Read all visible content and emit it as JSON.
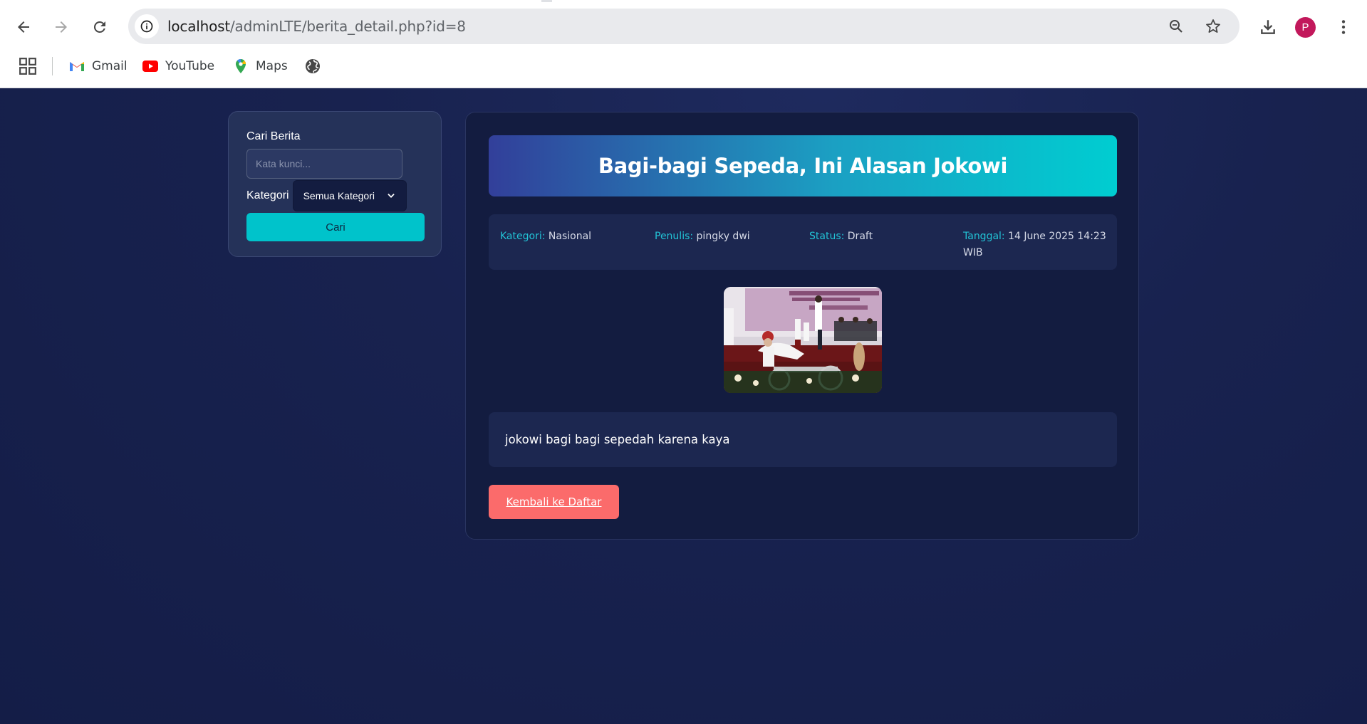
{
  "browser": {
    "url_host": "localhost",
    "url_path": "/adminLTE/berita_detail.php?id=8",
    "profile_initial": "P",
    "bookmarks": [
      {
        "label": "Gmail",
        "icon": "gmail-icon"
      },
      {
        "label": "YouTube",
        "icon": "youtube-icon"
      },
      {
        "label": "Maps",
        "icon": "maps-icon"
      }
    ]
  },
  "sidebar": {
    "search_label": "Cari Berita",
    "search_placeholder": "Kata kunci...",
    "category_label": "Kategori",
    "category_selected": "Semua Kategori",
    "search_button": "Cari"
  },
  "article": {
    "title": "Bagi-bagi Sepeda, Ini Alasan Jokowi",
    "meta": {
      "category_key": "Kategori:",
      "category_value": "Nasional",
      "author_key": "Penulis:",
      "author_value": "pingky dwi",
      "status_key": "Status:",
      "status_value": "Draft",
      "date_key": "Tanggal:",
      "date_value": "14 June 2025 14:23 WIB"
    },
    "body": "jokowi bagi bagi sepedah karena kaya",
    "back_button": "Kembali ke Daftar"
  },
  "colors": {
    "accent": "#00c3cb",
    "danger": "#fb6b6b",
    "background": "#18224f",
    "card": "#131c40"
  }
}
